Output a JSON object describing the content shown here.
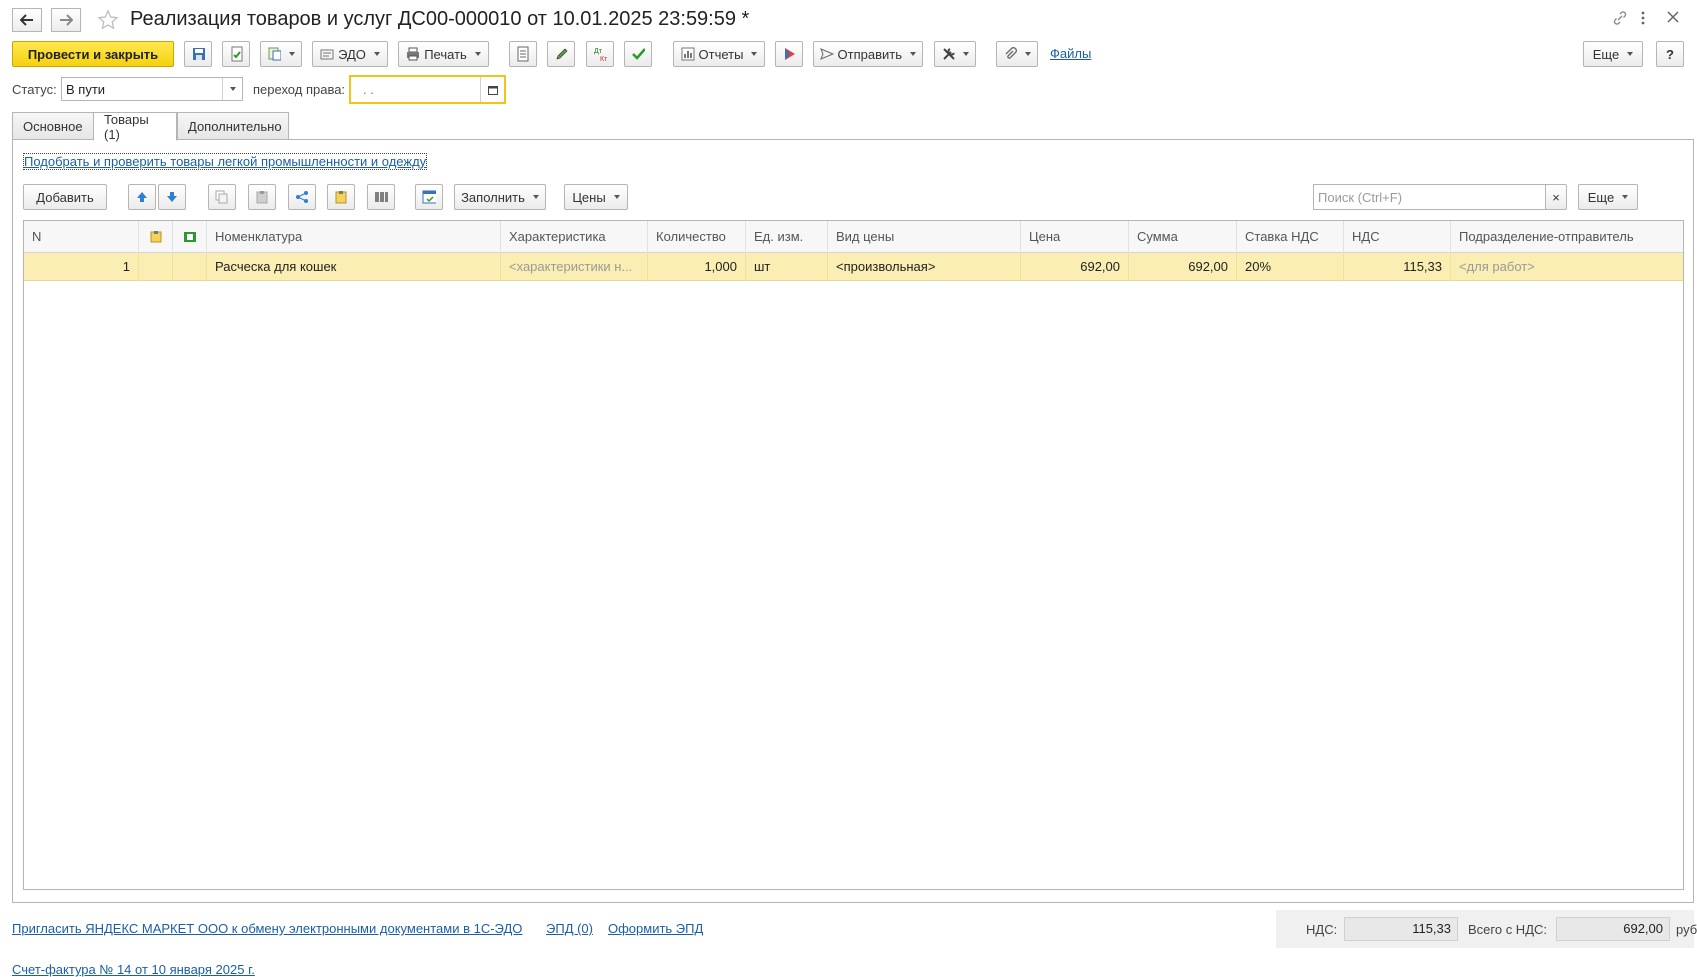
{
  "window": {
    "title": "Реализация товаров и услуг ДС00-000010 от 10.01.2025 23:59:59 *"
  },
  "toolbar": {
    "post_close": "Провести и закрыть",
    "edo": "ЭДО",
    "print": "Печать",
    "reports": "Отчеты",
    "send": "Отправить",
    "files": "Файлы",
    "more": "Еще",
    "help": "?"
  },
  "status": {
    "label": "Статус:",
    "value": "В пути",
    "transfer_label": "переход права:",
    "transfer_value": ". ."
  },
  "tabs": [
    {
      "label": "Основное"
    },
    {
      "label": "Товары (1)"
    },
    {
      "label": "Дополнительно"
    }
  ],
  "goods": {
    "pick_link": "Подобрать и проверить товары легкой промышленности и одежду",
    "add": "Добавить",
    "fill": "Заполнить",
    "prices": "Цены",
    "search_placeholder": "Поиск (Ctrl+F)",
    "search_clear": "×",
    "more": "Еще",
    "columns": {
      "n": "N",
      "nomenclature": "Номенклатура",
      "characteristic": "Характеристика",
      "quantity": "Количество",
      "unit": "Ед. изм.",
      "price_type": "Вид цены",
      "price": "Цена",
      "sum": "Сумма",
      "vat_rate": "Ставка НДС",
      "vat": "НДС",
      "division": "Подразделение-отправитель"
    },
    "rows": [
      {
        "n": "1",
        "nomenclature": "Расческа для кошек",
        "characteristic": "<характеристики н...",
        "quantity": "1,000",
        "unit": "шт",
        "price_type": "<произвольная>",
        "price": "692,00",
        "sum": "692,00",
        "vat_rate": "20%",
        "vat": "115,33",
        "division": "<для работ>"
      }
    ]
  },
  "footer": {
    "invite_link": "Пригласить ЯНДЕКС МАРКЕТ ООО к обмену электронными документами в 1С-ЭДО",
    "epd_link": "ЭПД (0)",
    "make_epd_link": "Оформить ЭПД",
    "invoice_link": "Счет-фактура № 14 от 10 января 2025 г.",
    "vat_label": "НДС:",
    "vat_value": "115,33",
    "total_label": "Всего с НДС:",
    "total_value": "692,00",
    "currency": "руб."
  },
  "colors": {
    "primary": "#f5d10f",
    "link": "#1a5fa8",
    "selected_row": "#fbeeb3",
    "focus_border": "#f0c419"
  }
}
